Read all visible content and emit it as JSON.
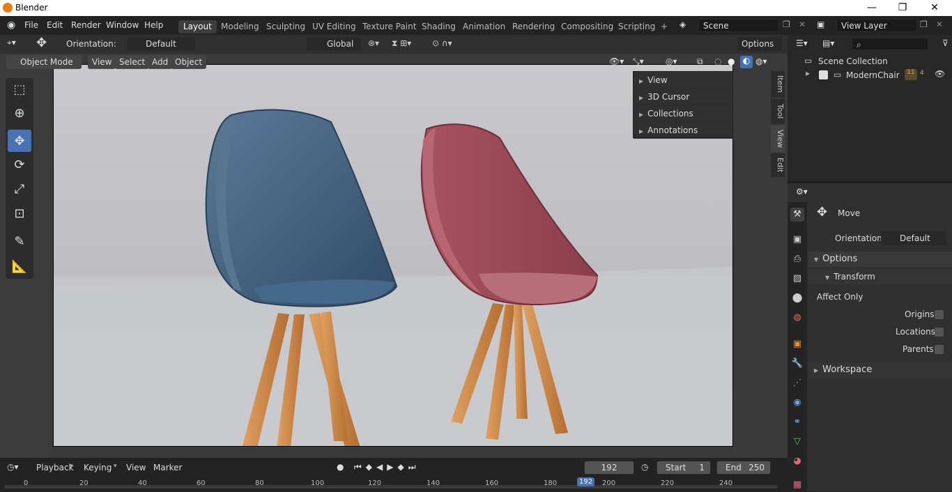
{
  "window": {
    "title": "Blender",
    "min": "—",
    "max": "❐",
    "close": "✕"
  },
  "menu": [
    "File",
    "Edit",
    "Render",
    "Window",
    "Help"
  ],
  "workspaces": [
    "Layout",
    "Modeling",
    "Sculpting",
    "UV Editing",
    "Texture Paint",
    "Shading",
    "Animation",
    "Rendering",
    "Compositing",
    "Scripting"
  ],
  "add_ws": "+",
  "scene": {
    "name": "Scene",
    "viewlayer": "View Layer"
  },
  "header": {
    "orientation_label": "Orientation:",
    "orientation_value": "Default",
    "transform_space": "Global",
    "options": "Options"
  },
  "viewport_menu": {
    "mode": "Object Mode",
    "view": "View",
    "select": "Select",
    "add": "Add",
    "object": "Object"
  },
  "npanel": {
    "items": [
      "View",
      "3D Cursor",
      "Collections",
      "Annotations"
    ],
    "tabs": [
      "Item",
      "Tool",
      "View",
      "Edit"
    ]
  },
  "outliner": {
    "collection": "Scene Collection",
    "object": "ModernChair",
    "badge1": "11",
    "badge2": "4"
  },
  "tool_props": {
    "title": "Move",
    "orientation_label": "Orientation",
    "orientation_value": "Default",
    "options": "Options",
    "transform": "Transform",
    "affect_only": "Affect Only",
    "origins": "Origins",
    "locations": "Locations",
    "parents": "Parents",
    "workspace": "Workspace"
  },
  "timeline": {
    "playback": "Playback",
    "keying": "Keying",
    "view": "View",
    "marker": "Marker",
    "current_frame": "192",
    "start_label": "Start",
    "start": "1",
    "end_label": "End",
    "end": "250",
    "ticks": [
      "0",
      "20",
      "40",
      "60",
      "80",
      "100",
      "120",
      "140",
      "160",
      "180",
      "192",
      "200",
      "220",
      "240"
    ]
  },
  "colors": {
    "accent": "#4772b3",
    "chair_blue": "#3f5f80",
    "chair_red": "#9a4a57",
    "legs": "#c47b3a"
  }
}
